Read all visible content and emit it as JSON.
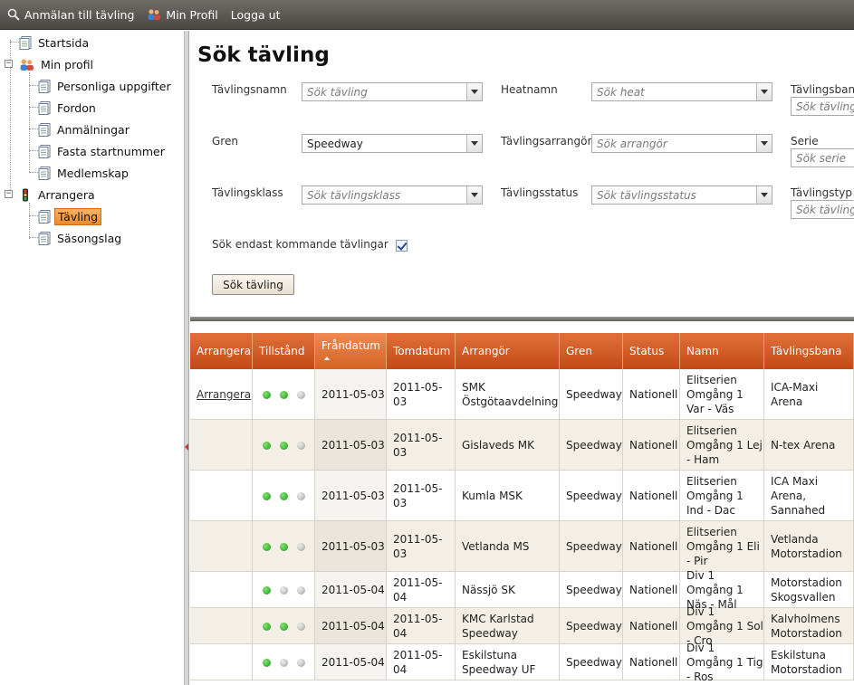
{
  "toolbar": {
    "items": [
      {
        "label": "Anmälan till tävling",
        "icon": "search-icon"
      },
      {
        "label": "Min Profil",
        "icon": "users-icon"
      },
      {
        "label": "Logga ut",
        "icon": ""
      }
    ]
  },
  "sidebar": {
    "startsida": "Startsida",
    "min_profil": "Min profil",
    "personliga": "Personliga uppgifter",
    "fordon": "Fordon",
    "anmalningar": "Anmälningar",
    "fasta": "Fasta startnummer",
    "medlemskap": "Medlemskap",
    "arrangera": "Arrangera",
    "tavling": "Tävling",
    "sasongslag": "Säsongslag"
  },
  "search": {
    "title": "Sök tävling",
    "fields": {
      "tavlingsnamn": {
        "label": "Tävlingsnamn",
        "placeholder": "Sök tävling"
      },
      "heatnamn": {
        "label": "Heatnamn",
        "placeholder": "Sök heat"
      },
      "tavlingsbana": {
        "label": "Tävlingsbana",
        "placeholder": "Sök tävlingsbana"
      },
      "gren": {
        "label": "Gren",
        "value": "Speedway"
      },
      "arrangor": {
        "label": "Tävlingsarrangör",
        "placeholder": "Sök arrangör"
      },
      "serie": {
        "label": "Serie",
        "placeholder": "Sök serie"
      },
      "klass": {
        "label": "Tävlingsklass",
        "placeholder": "Sök tävlingsklass"
      },
      "status": {
        "label": "Tävlingsstatus",
        "placeholder": "Sök tävlingsstatus"
      },
      "typ": {
        "label": "Tävlingstyp",
        "placeholder": "Sök tävlingstyp"
      }
    },
    "only_upcoming": "Sök endast kommande tävlingar",
    "only_upcoming_checked": true,
    "button": "Sök tävling"
  },
  "grid": {
    "columns": [
      "Arrangera",
      "Tillstånd",
      "Fråndatum",
      "Tomdatum",
      "Arrangör",
      "Gren",
      "Status",
      "Namn",
      "Tävlingsbana"
    ],
    "rows": [
      {
        "arrangera": "Arrangera",
        "dots": [
          "green",
          "green",
          "gray"
        ],
        "from": "2011-05-03",
        "to": "2011-05-03",
        "org": "SMK Östgötaavdelning",
        "gren": "Speedway",
        "status": "Nationell",
        "namn": "Elitserien Omgång 1 Var - Väs",
        "bana": "ICA-Maxi Arena"
      },
      {
        "arrangera": "",
        "dots": [
          "green",
          "green",
          "gray"
        ],
        "from": "2011-05-03",
        "to": "2011-05-03",
        "org": "Gislaveds MK",
        "gren": "Speedway",
        "status": "Nationell",
        "namn": "Elitserien Omgång 1 Lej - Ham",
        "bana": "N-tex Arena"
      },
      {
        "arrangera": "",
        "dots": [
          "green",
          "green",
          "gray"
        ],
        "from": "2011-05-03",
        "to": "2011-05-03",
        "org": "Kumla MSK",
        "gren": "Speedway",
        "status": "Nationell",
        "namn": "Elitserien Omgång 1 Ind - Dac",
        "bana": "ICA Maxi Arena, Sannahed"
      },
      {
        "arrangera": "",
        "dots": [
          "green",
          "green",
          "gray"
        ],
        "from": "2011-05-03",
        "to": "2011-05-03",
        "org": "Vetlanda MS",
        "gren": "Speedway",
        "status": "Nationell",
        "namn": "Elitserien Omgång 1 Eli - Pir",
        "bana": "Vetlanda Motorstadion"
      },
      {
        "arrangera": "",
        "dots": [
          "green",
          "gray",
          "gray"
        ],
        "from": "2011-05-04",
        "to": "2011-05-04",
        "org": "Nässjö SK",
        "gren": "Speedway",
        "status": "Nationell",
        "namn": "Div 1 Omgång 1 Näs - Mål",
        "bana": "Motorstadion Skogsvallen"
      },
      {
        "arrangera": "",
        "dots": [
          "green",
          "green",
          "gray"
        ],
        "from": "2011-05-04",
        "to": "2011-05-04",
        "org": "KMC Karlstad Speedway",
        "gren": "Speedway",
        "status": "Nationell",
        "namn": "Div 1 Omgång 1 Sol - Cro",
        "bana": "Kalvholmens Motorstadion"
      },
      {
        "arrangera": "",
        "dots": [
          "green",
          "gray",
          "gray"
        ],
        "from": "2011-05-04",
        "to": "2011-05-04",
        "org": "Eskilstuna Speedway UF",
        "gren": "Speedway",
        "status": "Nationell",
        "namn": "Div 1 Omgång 1 Tig - Ros",
        "bana": "Eskilstuna Motorstadion"
      }
    ]
  }
}
